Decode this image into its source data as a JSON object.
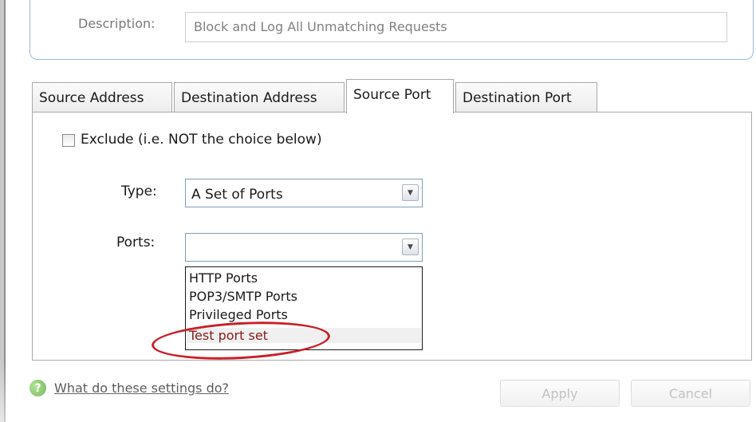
{
  "general": {
    "description_label": "Description:",
    "description_value": "Block and Log All Unmatching Requests"
  },
  "tabs": [
    {
      "label": "Source Address",
      "active": false
    },
    {
      "label": "Destination Address",
      "active": false
    },
    {
      "label": "Source Port",
      "active": true
    },
    {
      "label": "Destination Port",
      "active": false
    }
  ],
  "source_port": {
    "exclude_label": "Exclude (i.e. NOT the choice below)",
    "exclude_checked": false,
    "type_label": "Type:",
    "type_value": "A Set of Ports",
    "ports_label": "Ports:",
    "ports_value": "",
    "ports_options": [
      "HTTP Ports",
      "POP3/SMTP Ports",
      "Privileged Ports",
      "Test port set"
    ],
    "highlighted_option": "Test port set"
  },
  "footer": {
    "help_link": "What do these settings do?",
    "apply_label": "Apply",
    "cancel_label": "Cancel"
  },
  "icons": {
    "help": "help-question-icon",
    "dropdown": "chevron-down-icon"
  },
  "colors": {
    "highlight_text": "#8b1a1a",
    "annotation_circle": "#c8202a",
    "panel_border": "#9bb6d6"
  }
}
